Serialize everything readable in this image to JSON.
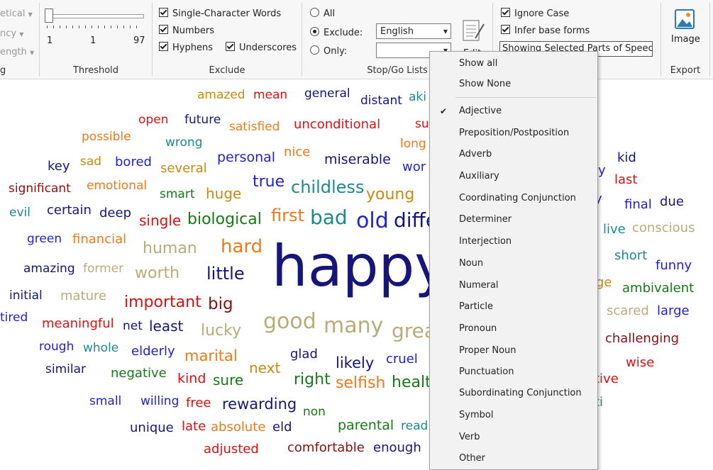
{
  "ribbon": {
    "left_partial": {
      "item1": "etical",
      "item2": "ncy",
      "item3": "ength",
      "group_label": "g"
    },
    "threshold": {
      "label_min": "1",
      "label_mid": "1",
      "label_max": "97",
      "group_label": "Threshold"
    },
    "exclude": {
      "single_char": "Single-Character Words",
      "numbers": "Numbers",
      "hyphens": "Hyphens",
      "underscores": "Underscores",
      "group_label": "Exclude"
    },
    "stopgo": {
      "all": "All",
      "exclude": "Exclude:",
      "only": "Only:",
      "language": "English",
      "edit": "Edit",
      "group_label": "Stop/Go Lists"
    },
    "options": {
      "ignore_case": "Ignore Case",
      "infer_base": "Infer base forms",
      "pos_button": "Showing Selected Parts of Speech"
    },
    "export": {
      "image": "Image",
      "group_label": "Export"
    }
  },
  "menu": {
    "items": [
      {
        "label": "Show all",
        "checked": false
      },
      {
        "label": "Show None",
        "checked": false
      },
      {
        "label": "Adjective",
        "checked": true
      },
      {
        "label": "Preposition/Postposition",
        "checked": false
      },
      {
        "label": "Adverb",
        "checked": false
      },
      {
        "label": "Auxiliary",
        "checked": false
      },
      {
        "label": "Coordinating Conjunction",
        "checked": false
      },
      {
        "label": "Determiner",
        "checked": false
      },
      {
        "label": "Interjection",
        "checked": false
      },
      {
        "label": "Noun",
        "checked": false
      },
      {
        "label": "Numeral",
        "checked": false
      },
      {
        "label": "Particle",
        "checked": false
      },
      {
        "label": "Pronoun",
        "checked": false
      },
      {
        "label": "Proper Noun",
        "checked": false
      },
      {
        "label": "Punctuation",
        "checked": false
      },
      {
        "label": "Subordinating Conjunction",
        "checked": false
      },
      {
        "label": "Symbol",
        "checked": false
      },
      {
        "label": "Verb",
        "checked": false
      },
      {
        "label": "Other",
        "checked": false
      }
    ]
  },
  "colors": {
    "navy": "#16167a",
    "blue": "#1f1fd6",
    "red": "#e01010",
    "orange": "#f07a1a",
    "khaki": "#b8ad7a",
    "teal": "#1d8a8a",
    "green": "#177a17",
    "darkred": "#8b1010",
    "gold": "#c98a10"
  },
  "cloud": {
    "words": [
      {
        "text": "amazed",
        "color": "#c98a10"
      },
      {
        "text": "mean",
        "color": "#e01010"
      },
      {
        "text": "general",
        "color": "#16167a"
      },
      {
        "text": "distant",
        "color": "#16167a"
      },
      {
        "text": "aki",
        "color": "#1d8a8a"
      },
      {
        "text": "open",
        "color": "#e01010"
      },
      {
        "text": "future",
        "color": "#16167a"
      },
      {
        "text": "satisfied",
        "color": "#f07a1a"
      },
      {
        "text": "unconditional",
        "color": "#e01010"
      },
      {
        "text": "su",
        "color": "#e01010"
      },
      {
        "text": "possible",
        "color": "#f07a1a"
      },
      {
        "text": "wrong",
        "color": "#1d8a8a"
      },
      {
        "text": "long",
        "color": "#f07a1a"
      },
      {
        "text": "key",
        "color": "#16167a"
      },
      {
        "text": "sad",
        "color": "#c98a10"
      },
      {
        "text": "bored",
        "color": "#1f1fd6"
      },
      {
        "text": "several",
        "color": "#c98a10"
      },
      {
        "text": "personal",
        "color": "#1f1fd6"
      },
      {
        "text": "nice",
        "color": "#f07a1a"
      },
      {
        "text": "miserable",
        "color": "#16167a"
      },
      {
        "text": "wor",
        "color": "#1f1fd6"
      },
      {
        "text": "significant",
        "color": "#8b1010"
      },
      {
        "text": "emotional",
        "color": "#f07a1a"
      },
      {
        "text": "smart",
        "color": "#177a17"
      },
      {
        "text": "huge",
        "color": "#c98a10"
      },
      {
        "text": "true",
        "color": "#1f1fd6"
      },
      {
        "text": "childless",
        "color": "#1d8a8a"
      },
      {
        "text": "young",
        "color": "#c98a10"
      },
      {
        "text": "evil",
        "color": "#1d8a8a"
      },
      {
        "text": "certain",
        "color": "#16167a"
      },
      {
        "text": "deep",
        "color": "#16167a"
      },
      {
        "text": "single",
        "color": "#e01010"
      },
      {
        "text": "biological",
        "color": "#177a17"
      },
      {
        "text": "first",
        "color": "#f07a1a"
      },
      {
        "text": "bad",
        "color": "#1d8a8a"
      },
      {
        "text": "old",
        "color": "#1f1fd6"
      },
      {
        "text": "diffe",
        "color": "#16167a"
      },
      {
        "text": "green",
        "color": "#1f1fd6"
      },
      {
        "text": "financial",
        "color": "#f07a1a"
      },
      {
        "text": "human",
        "color": "#b8ad7a"
      },
      {
        "text": "hard",
        "color": "#f07a1a"
      },
      {
        "text": "amazing",
        "color": "#16167a"
      },
      {
        "text": "former",
        "color": "#b8ad7a"
      },
      {
        "text": "worth",
        "color": "#b8ad7a"
      },
      {
        "text": "little",
        "color": "#16167a"
      },
      {
        "text": "happy",
        "color": "#16167a"
      },
      {
        "text": "initial",
        "color": "#16167a"
      },
      {
        "text": "mature",
        "color": "#b8ad7a"
      },
      {
        "text": "important",
        "color": "#e01010"
      },
      {
        "text": "big",
        "color": "#8b1010"
      },
      {
        "text": "tired",
        "color": "#1f1fd6"
      },
      {
        "text": "meaningful",
        "color": "#e01010"
      },
      {
        "text": "net",
        "color": "#16167a"
      },
      {
        "text": "least",
        "color": "#16167a"
      },
      {
        "text": "lucky",
        "color": "#b8ad7a"
      },
      {
        "text": "good",
        "color": "#b8ad7a"
      },
      {
        "text": "many",
        "color": "#b8ad7a"
      },
      {
        "text": "grea",
        "color": "#b8ad7a"
      },
      {
        "text": "rough",
        "color": "#1f1fd6"
      },
      {
        "text": "whole",
        "color": "#1d8a8a"
      },
      {
        "text": "elderly",
        "color": "#1f1fd6"
      },
      {
        "text": "marital",
        "color": "#f07a1a"
      },
      {
        "text": "glad",
        "color": "#16167a"
      },
      {
        "text": "likely",
        "color": "#16167a"
      },
      {
        "text": "cruel",
        "color": "#1f1fd6"
      },
      {
        "text": "similar",
        "color": "#16167a"
      },
      {
        "text": "negative",
        "color": "#177a17"
      },
      {
        "text": "kind",
        "color": "#e01010"
      },
      {
        "text": "sure",
        "color": "#177a17"
      },
      {
        "text": "next",
        "color": "#c98a10"
      },
      {
        "text": "right",
        "color": "#177a17"
      },
      {
        "text": "selfish",
        "color": "#f07a1a"
      },
      {
        "text": "healt",
        "color": "#177a17"
      },
      {
        "text": "small",
        "color": "#1f1fd6"
      },
      {
        "text": "willing",
        "color": "#1f1fd6"
      },
      {
        "text": "free",
        "color": "#e01010"
      },
      {
        "text": "rewarding",
        "color": "#16167a"
      },
      {
        "text": "non",
        "color": "#177a17"
      },
      {
        "text": "unique",
        "color": "#16167a"
      },
      {
        "text": "late",
        "color": "#e01010"
      },
      {
        "text": "absolute",
        "color": "#f07a1a"
      },
      {
        "text": "eld",
        "color": "#16167a"
      },
      {
        "text": "parental",
        "color": "#177a17"
      },
      {
        "text": "read",
        "color": "#1d8a8a"
      },
      {
        "text": "adjusted",
        "color": "#e01010"
      },
      {
        "text": "comfortable",
        "color": "#8b1010"
      },
      {
        "text": "enough",
        "color": "#16167a"
      },
      {
        "text": "kid",
        "color": "#16167a"
      },
      {
        "text": "ly",
        "color": "#1f1fd6"
      },
      {
        "text": "last",
        "color": "#e01010"
      },
      {
        "text": "y",
        "color": "#1f1fd6"
      },
      {
        "text": "final",
        "color": "#1f1fd6"
      },
      {
        "text": "due",
        "color": "#16167a"
      },
      {
        "text": "live",
        "color": "#1d8a8a"
      },
      {
        "text": "conscious",
        "color": "#b8ad7a"
      },
      {
        "text": "short",
        "color": "#1d8a8a"
      },
      {
        "text": "funny",
        "color": "#1f1fd6"
      },
      {
        "text": "ge",
        "color": "#c98a10"
      },
      {
        "text": "ambivalent",
        "color": "#177a17"
      },
      {
        "text": "scared",
        "color": "#b8ad7a"
      },
      {
        "text": "large",
        "color": "#1f1fd6"
      },
      {
        "text": "challenging",
        "color": "#8b1010"
      },
      {
        "text": "wise",
        "color": "#e01010"
      },
      {
        "text": "tive",
        "color": "#e01010"
      },
      {
        "text": "ti",
        "color": "#1d8a8a"
      }
    ]
  }
}
